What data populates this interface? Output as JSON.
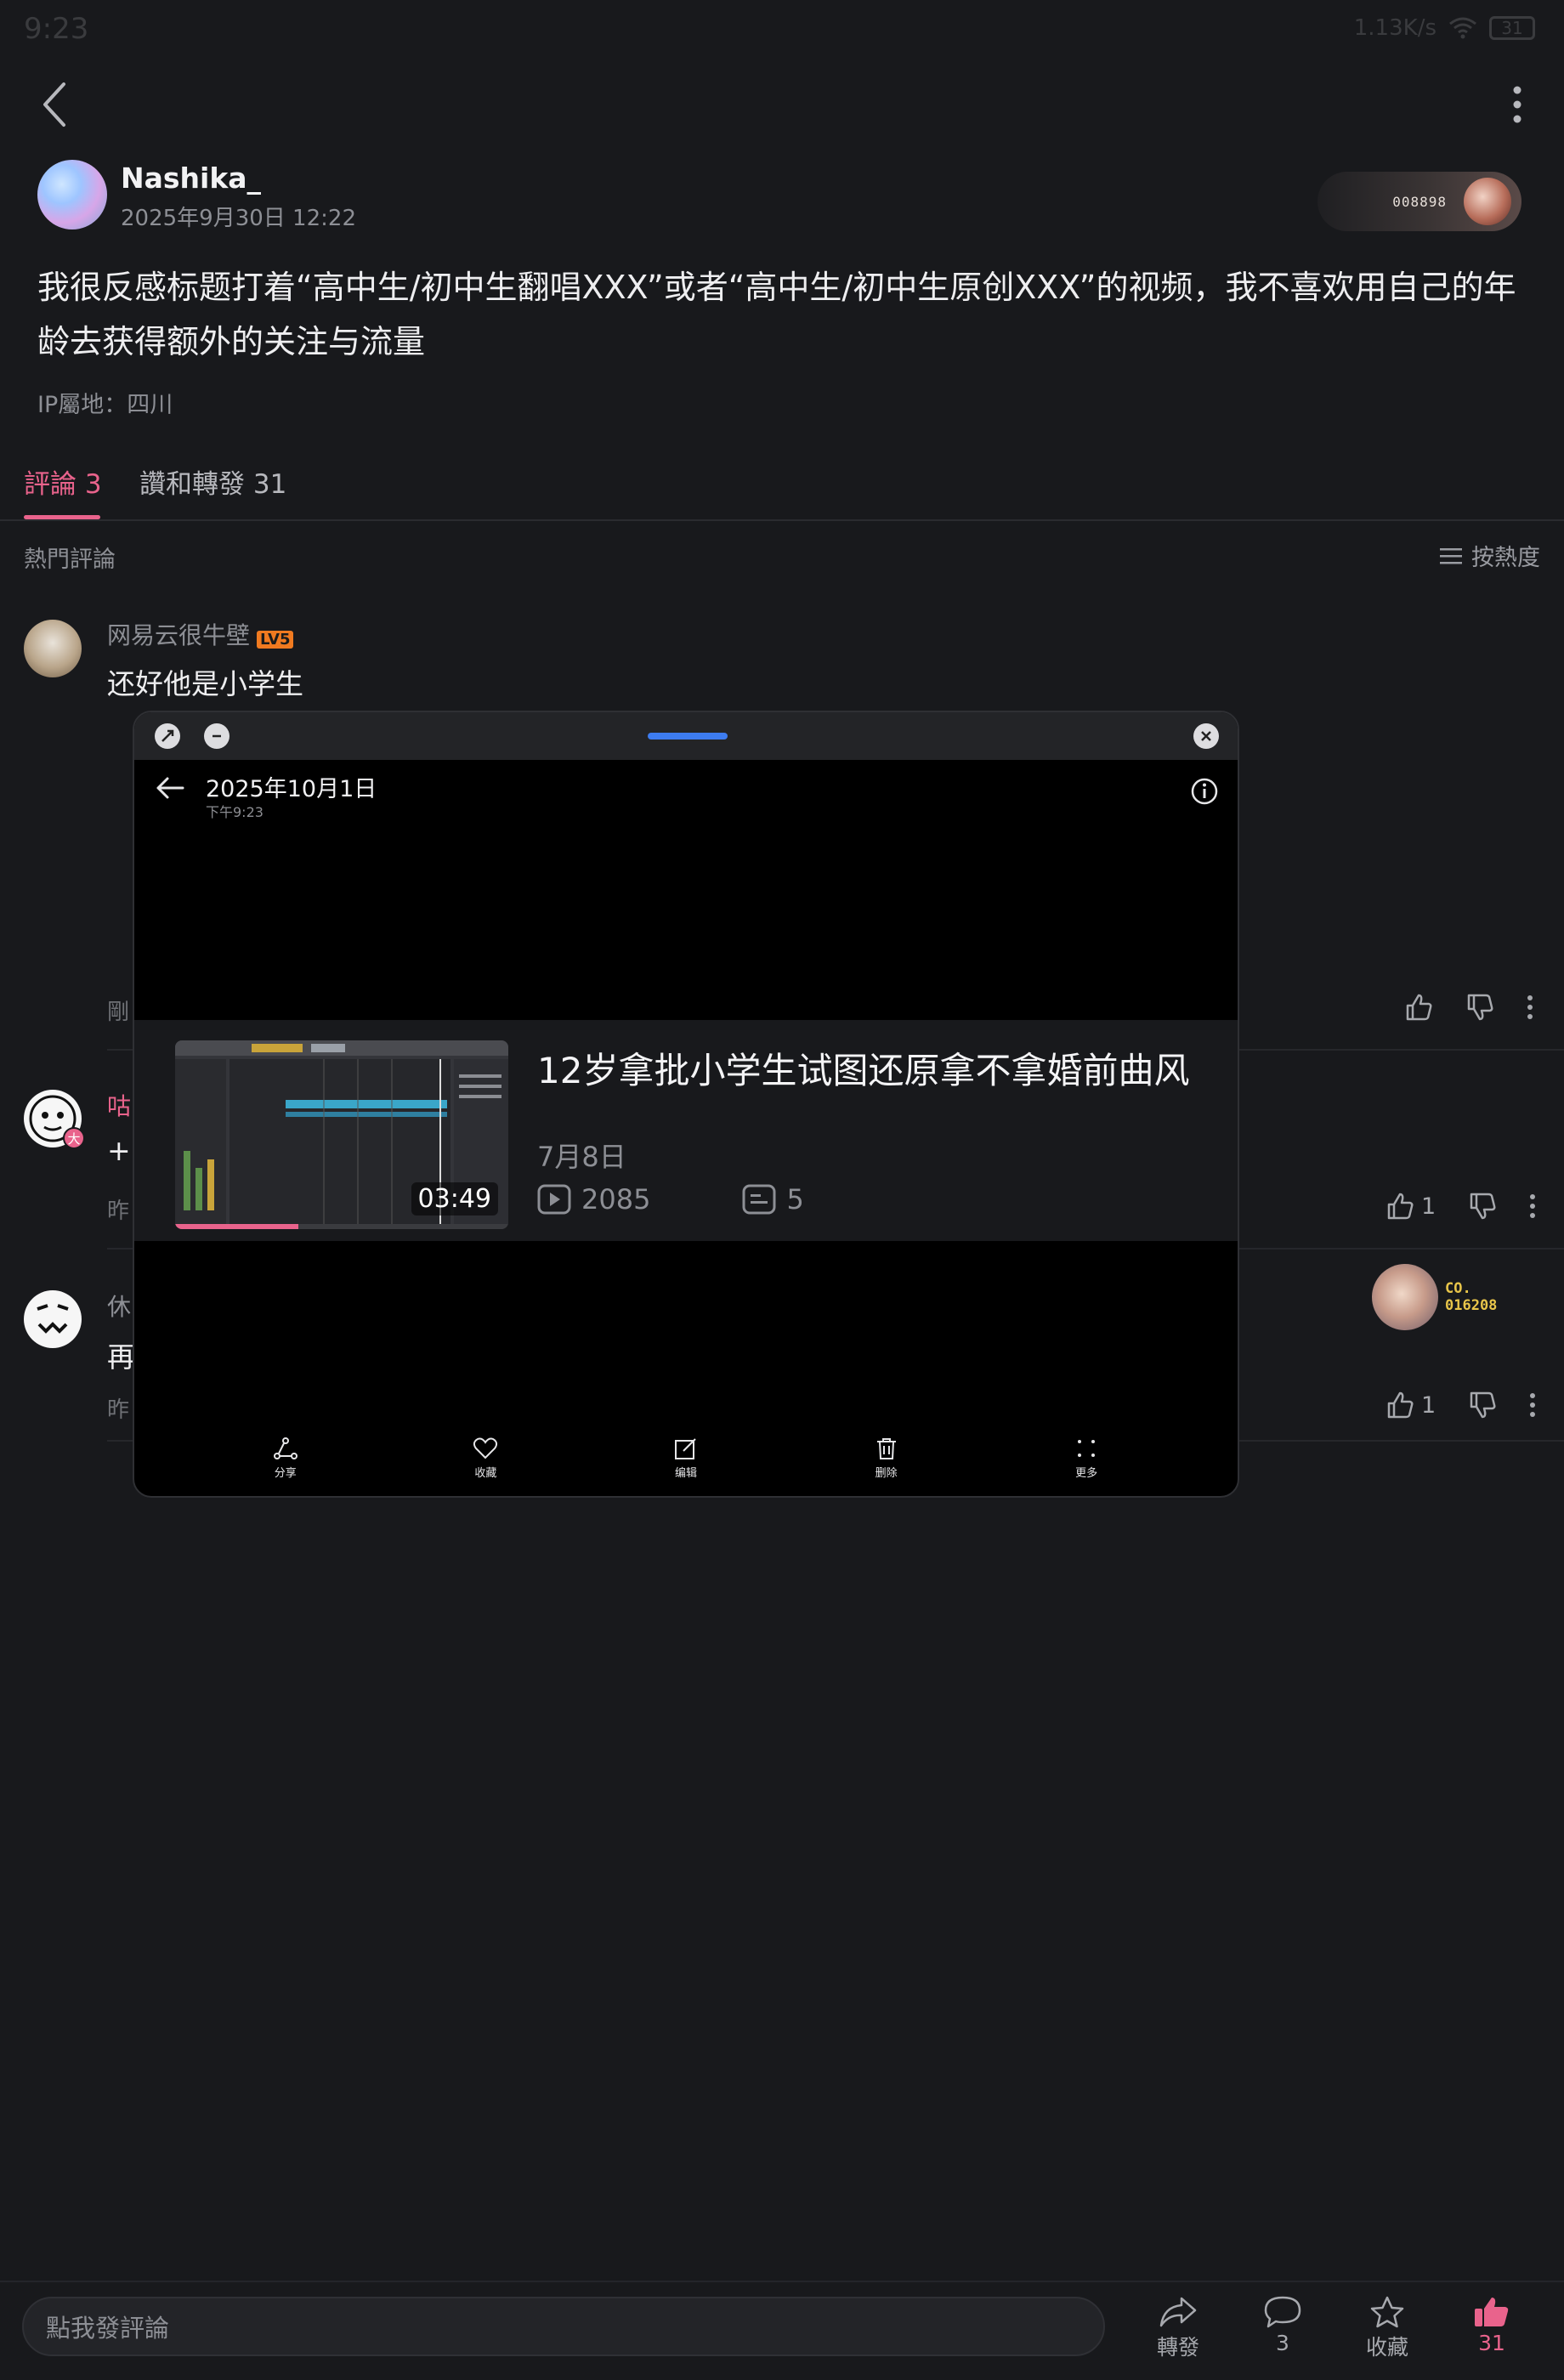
{
  "status_bar": {
    "time": "9:23",
    "net_speed": "1.13K/s",
    "battery": "31"
  },
  "post": {
    "author": "Nashika_",
    "time": "2025年9月30日 12:22",
    "decor_code": "008898",
    "body": "我很反感标题打着“高中生/初中生翻唱XXX”或者“高中生/初中生原创XXX”的视频，我不喜欢用自己的年龄去获得额外的关注与流量",
    "ip": "IP屬地：四川"
  },
  "tabs": {
    "comments": "評論 3",
    "likes": "讚和轉發 31"
  },
  "hot": {
    "title": "熱門評論",
    "sort": "按熱度"
  },
  "comments": [
    {
      "user": "网易云很牛壁",
      "level": "LV5",
      "text": "还好他是小学生",
      "time": "剛",
      "likes": ""
    },
    {
      "user": "咕",
      "badge": "大",
      "text": "+",
      "time": "昨",
      "likes": "1"
    },
    {
      "user": "休",
      "text": "再",
      "time": "昨",
      "likes": "1",
      "medal_code_1": "CO.",
      "medal_code_2": "016208"
    }
  ],
  "floating_window": {
    "date_title": "2025年10月1日",
    "date_sub": "下午9:23",
    "video": {
      "title": "12岁拿批小学生试图还原拿不拿婚前曲风",
      "duration": "03:49",
      "date": "7月8日",
      "views": "2085",
      "comments": "5",
      "progress": 0.37
    },
    "toolbar": {
      "share": "分享",
      "favorite": "收藏",
      "edit": "编辑",
      "delete": "删除",
      "more": "更多"
    }
  },
  "bottom_bar": {
    "input_placeholder": "點我發評論",
    "forward": "轉發",
    "comment_count": "3",
    "favorite": "收藏",
    "like_count": "31"
  },
  "colors": {
    "accent": "#e9638c",
    "background": "#18191c",
    "handle": "#3d7cf0"
  }
}
